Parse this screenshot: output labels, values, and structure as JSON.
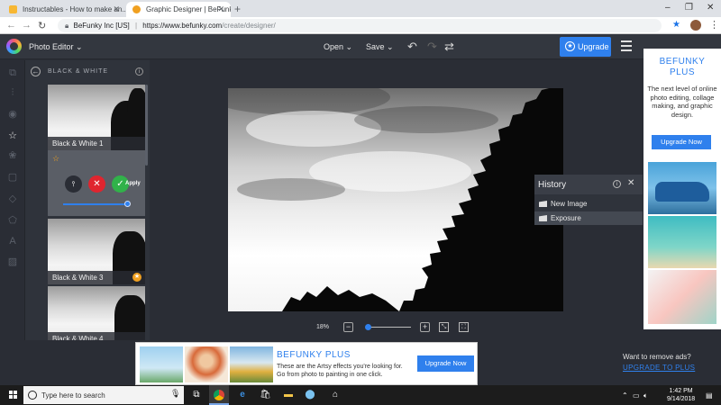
{
  "browser": {
    "tabs": [
      {
        "title": "Instructables - How to make an..."
      },
      {
        "title": "Graphic Designer | BeFunky: Free..."
      }
    ],
    "site_identity": "BeFunky Inc [US]",
    "url_host": "https://www.befunky.com",
    "url_path": "/create/designer/"
  },
  "app": {
    "title": "Photo Editor",
    "open_label": "Open",
    "save_label": "Save",
    "upgrade_label": "Upgrade"
  },
  "panel": {
    "title": "BLACK & WHITE",
    "effects": [
      {
        "label": "Black & White 1"
      },
      {
        "label": "Black & White 3"
      },
      {
        "label": "Black & White 4"
      }
    ],
    "apply_label": "Apply",
    "amount": 0.95
  },
  "history": {
    "title": "History",
    "items": [
      "New Image",
      "Exposure"
    ]
  },
  "zoom": {
    "percent_label": "18%"
  },
  "side_ad": {
    "title": "BEFUNKY\nPLUS",
    "text": "The next level of online photo editing, collage making, and graphic design.",
    "button": "Upgrade Now"
  },
  "bottom_ad": {
    "title": "BEFUNKY PLUS",
    "text": "These are the Artsy effects you're looking for. Go from photo to painting in one click.",
    "button": "Upgrade Now",
    "remove_text": "Want to remove ads?",
    "remove_link": "UPGRADE TO PLUS"
  },
  "taskbar": {
    "search_placeholder": "Type here to search",
    "time": "1:42 PM",
    "date": "9/14/2018"
  },
  "colors": {
    "accent": "#2f80ed",
    "cancel": "#e0252f",
    "apply": "#31b24a",
    "favorite": "#f0a020"
  }
}
